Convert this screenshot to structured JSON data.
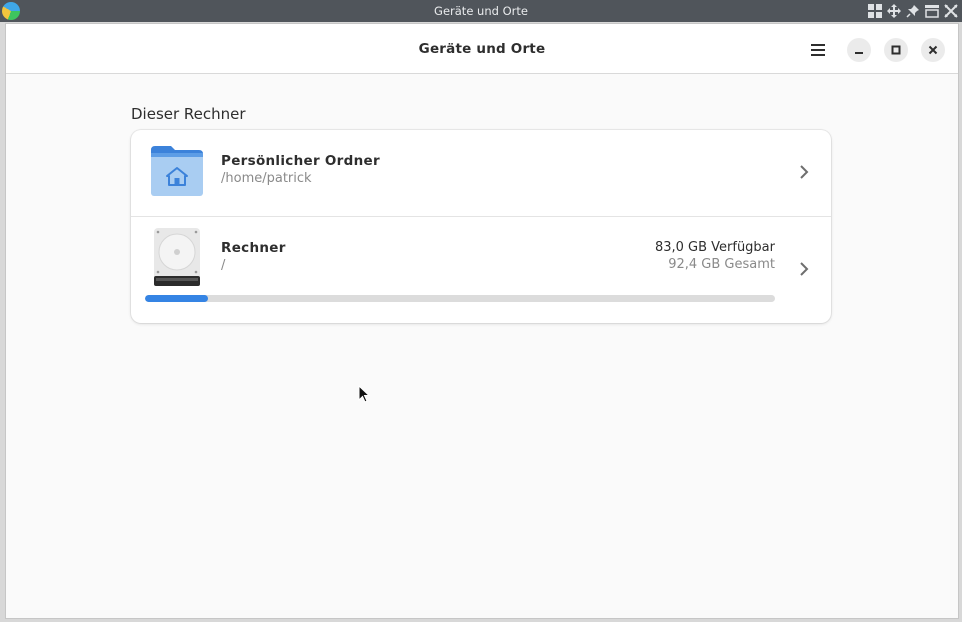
{
  "wm": {
    "title": "Geräte und Orte",
    "icons": [
      "app-logo-icon",
      "tile-grid-icon",
      "move-icon",
      "pin-icon",
      "shade-icon",
      "close-x-icon"
    ]
  },
  "window": {
    "title": "Geräte und Orte",
    "menu_icon": "hamburger-menu-icon",
    "buttons": [
      "minimize-icon",
      "maximize-icon",
      "close-icon"
    ]
  },
  "section": {
    "title": "Dieser Rechner"
  },
  "places": [
    {
      "name": "Persönlicher Ordner",
      "path": "/home/patrick",
      "icon": "home-folder-icon"
    },
    {
      "name": "Rechner",
      "path": "/",
      "icon": "hard-disk-icon",
      "available": "83,0 GB Verfügbar",
      "total": "92,4 GB Gesamt",
      "used_fraction": 0.1
    }
  ],
  "colors": {
    "accent": "#3584e4",
    "folder": "#4a90e2"
  }
}
